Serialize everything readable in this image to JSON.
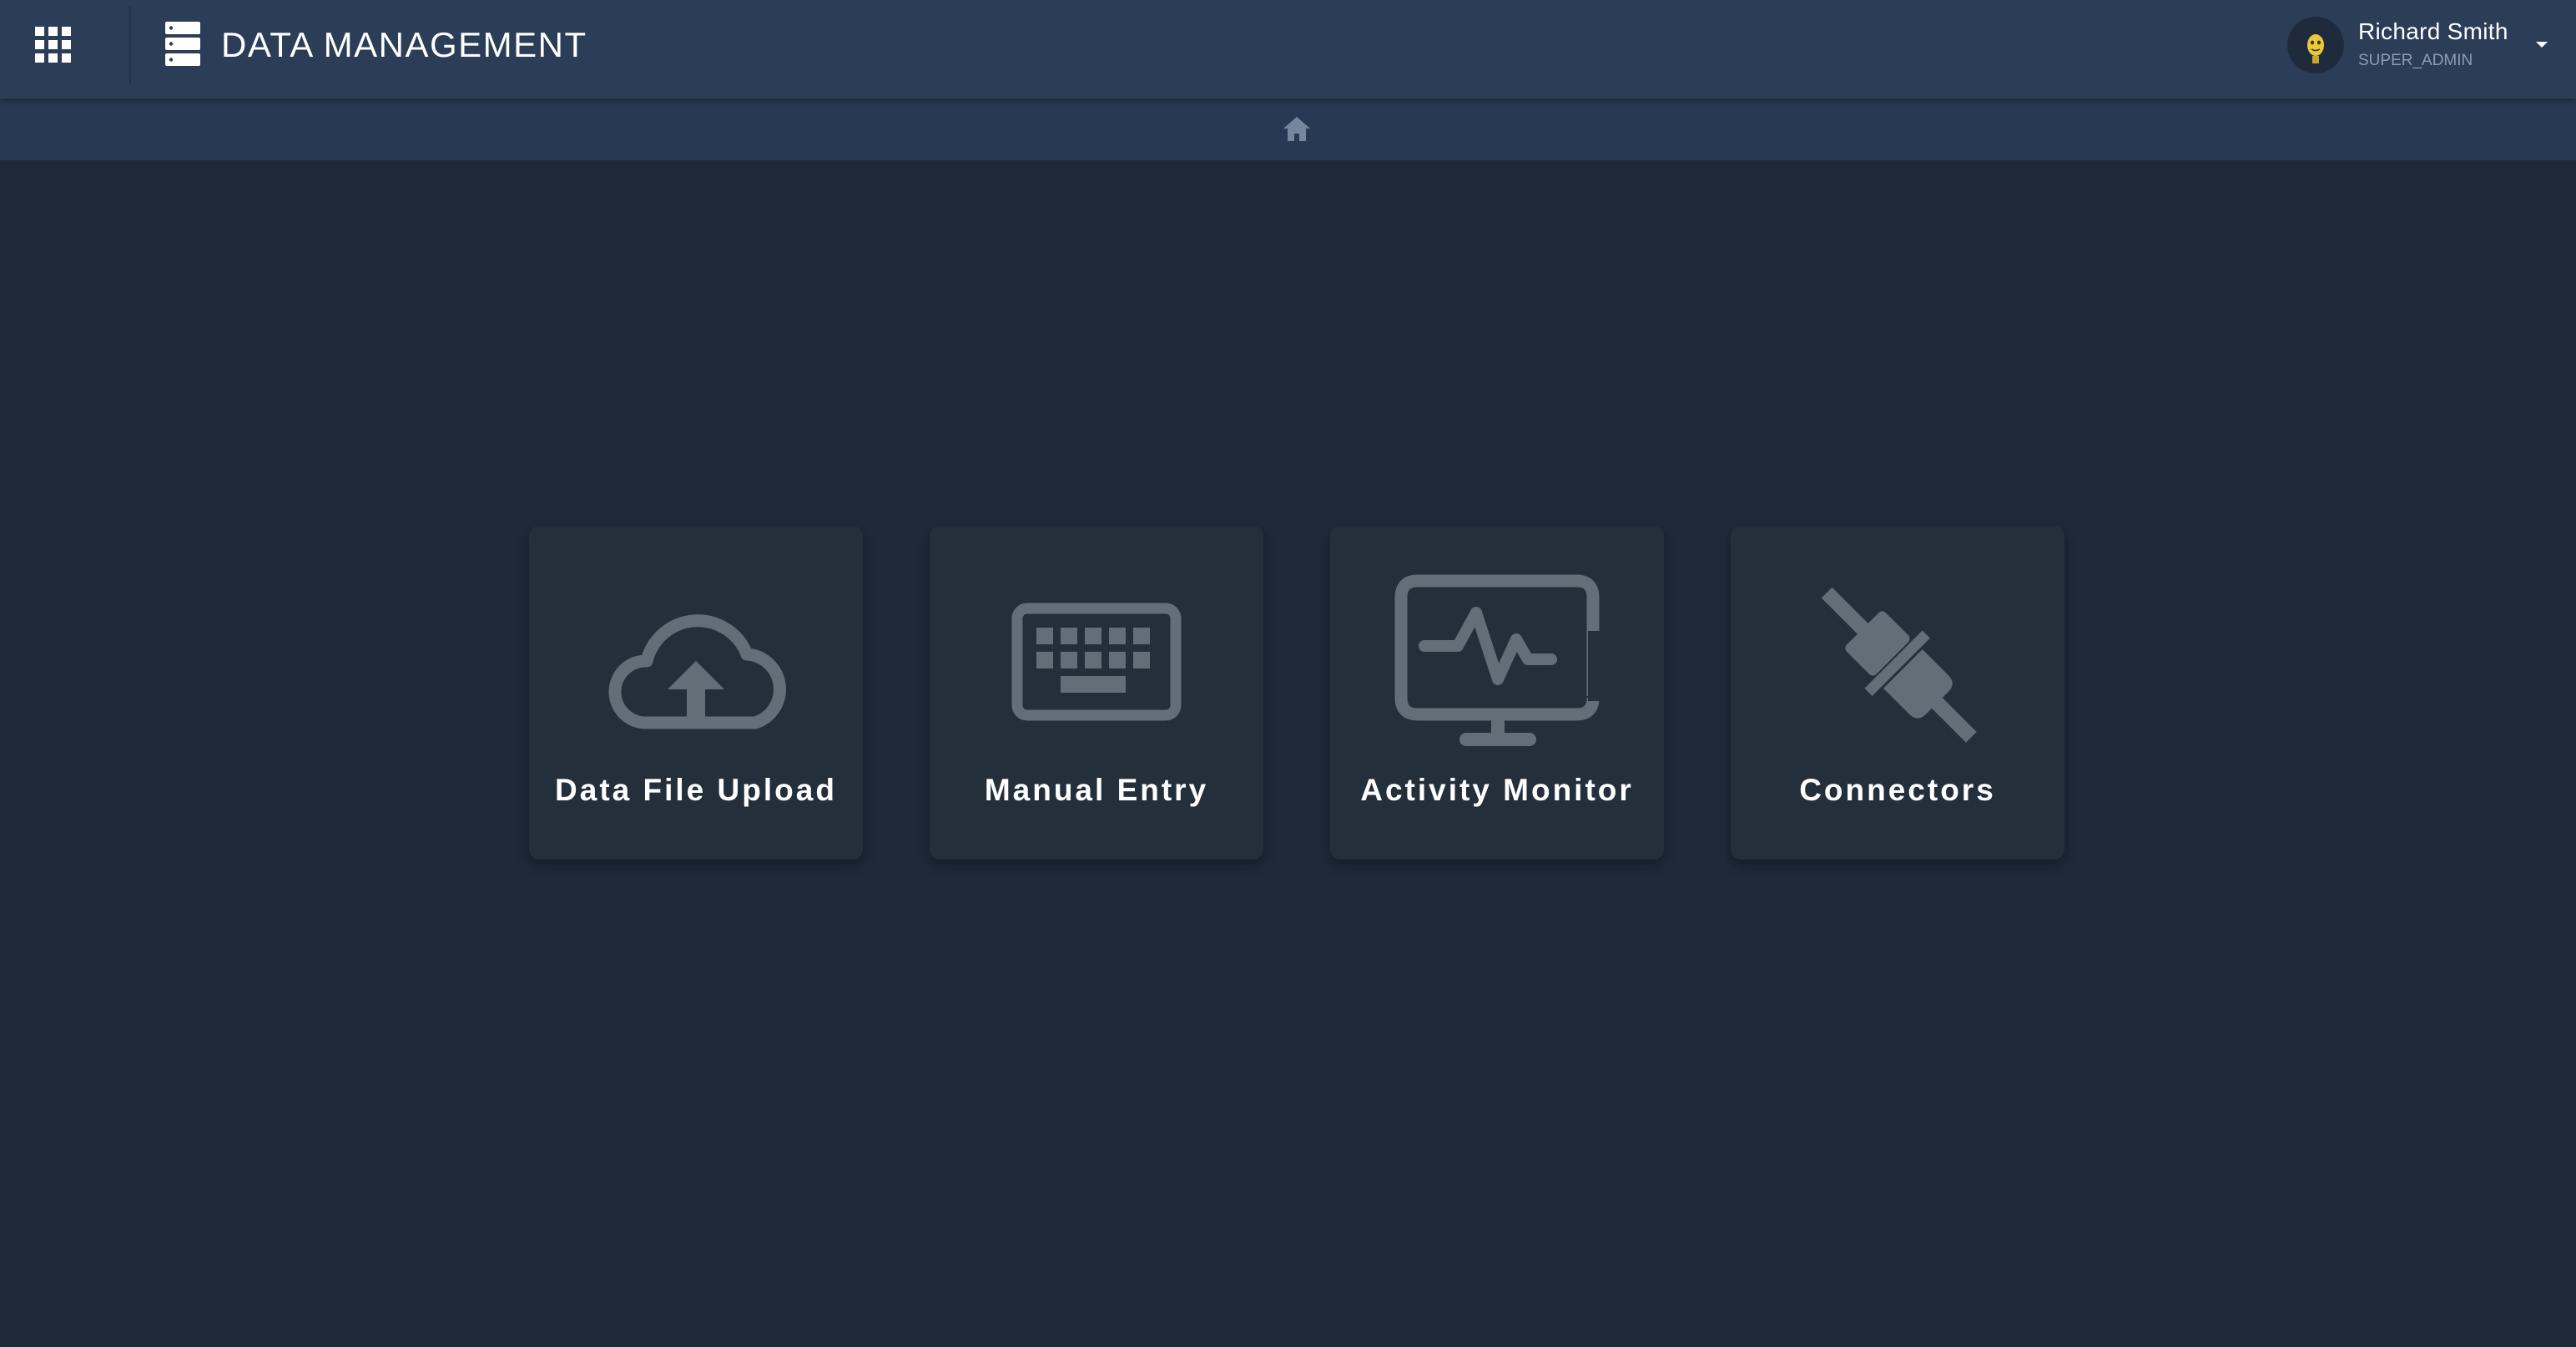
{
  "header": {
    "apps_icon": "apps-grid-icon",
    "logo_icon": "storage-icon",
    "title": "DATA MANAGEMENT",
    "user": {
      "name": "Richard Smith",
      "role": "SUPER_ADMIN",
      "avatar_icon": "user-avatar",
      "menu_icon": "caret-down-icon"
    }
  },
  "breadcrumb": {
    "home_icon": "home-icon"
  },
  "tiles": [
    {
      "label": "Data File Upload",
      "icon": "cloud-upload-icon"
    },
    {
      "label": "Manual Entry",
      "icon": "keyboard-icon"
    },
    {
      "label": "Activity Monitor",
      "icon": "monitor-heart-icon"
    },
    {
      "label": "Connectors",
      "icon": "plug-icon"
    }
  ],
  "colors": {
    "background": "#1e2a3a",
    "topbar": "#2b3d57",
    "breadcrumb_bar": "#283a53",
    "tile": "#242f3c",
    "icon_gray": "#646e78",
    "text": "#ffffff",
    "role_text": "#8e9cb0"
  }
}
